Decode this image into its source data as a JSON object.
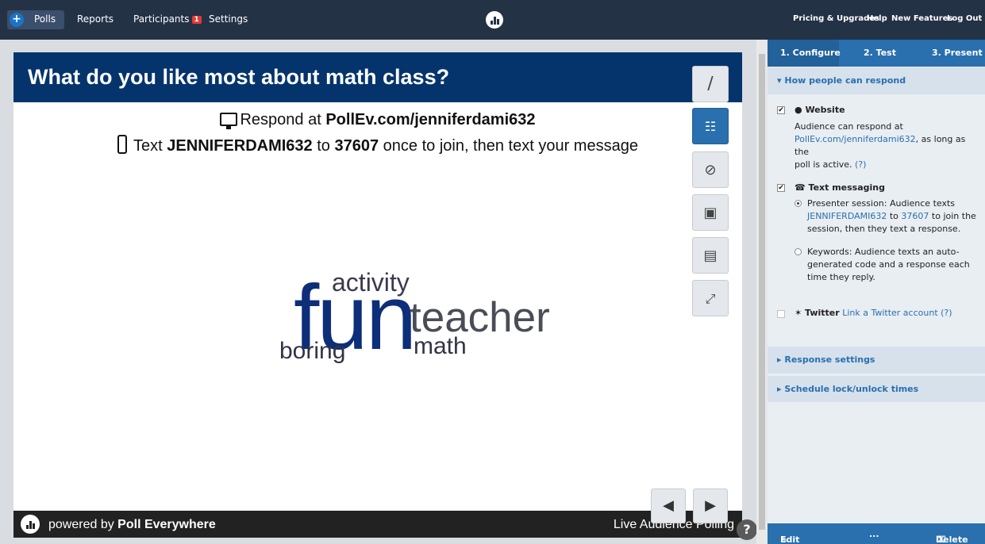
{
  "nav": {
    "polls": "Polls",
    "reports": "Reports",
    "participants": "Participants",
    "participants_badge": "1",
    "settings": "Settings",
    "pricing": "Pricing & Upgrades",
    "help": "Help",
    "new_features": "New Features",
    "logout": "Log Out"
  },
  "slide": {
    "title": "What do you like most about math class?",
    "respond_prefix": "Respond at ",
    "respond_url": "PollEv.com/jenniferdami632",
    "text_prefix": "Text ",
    "text_code": "JENNIFERDAMI632",
    "text_mid": " to ",
    "text_number": "37607",
    "text_suffix": " once to join, then text your message",
    "words": [
      "activity",
      "fun",
      "teacher",
      "boring",
      "math"
    ],
    "powered_prefix": "powered by ",
    "powered_brand": "Poll Everywhere",
    "live": "Live Audience Polling"
  },
  "sidebar": {
    "step1": "1. Configure",
    "step2": "2. Test",
    "step3": "3. Present",
    "how_respond": "How people can respond",
    "website_label": "Website",
    "website_desc_1": "Audience can respond at",
    "website_url": "PollEv.com/jenniferdami632",
    "website_desc_2": ", as long as the",
    "website_desc_3": "poll is active.",
    "help_q": "(?)",
    "text_msg_label": "Text messaging",
    "presenter_1": "Presenter session: Audience texts",
    "presenter_code": "JENNIFERDAMI632",
    "presenter_to": " to ",
    "presenter_number": "37607",
    "presenter_2": " to join the",
    "presenter_3": "session, then they text a response.",
    "keywords_1": "Keywords: Audience texts an auto-",
    "keywords_2": "generated code and a response each",
    "keywords_3": "time they reply.",
    "twitter_label": "Twitter",
    "twitter_link": "Link a Twitter account",
    "response_settings": "Response settings",
    "schedule": "Schedule lock/unlock times",
    "edit_poll": "Edit poll",
    "more": "...",
    "delete": "Delete"
  }
}
